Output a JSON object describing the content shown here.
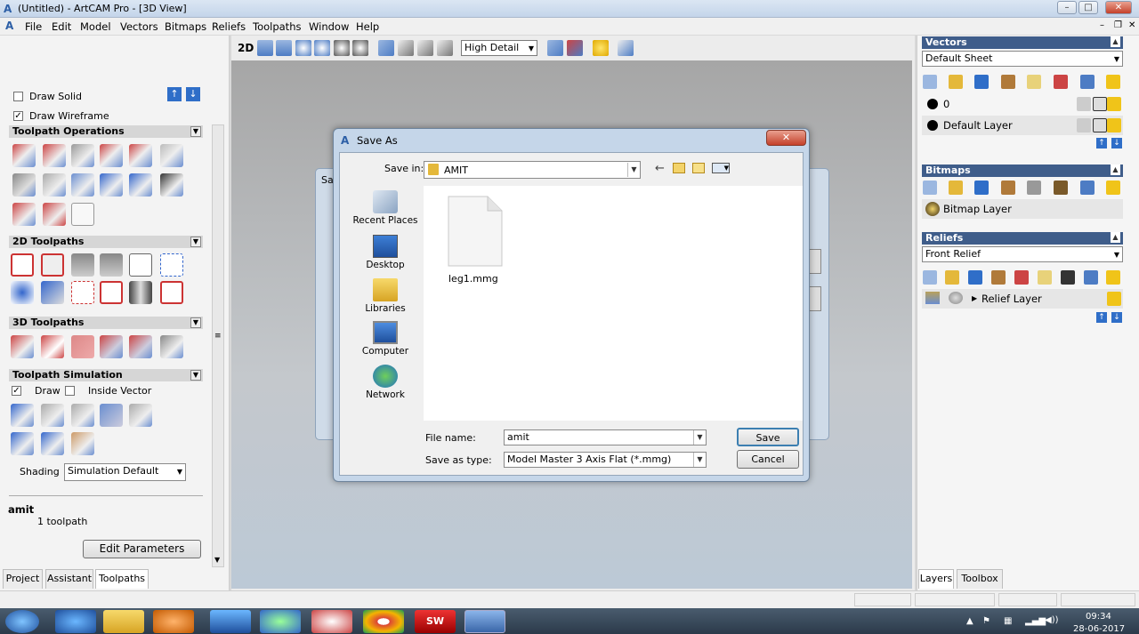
{
  "window": {
    "title": "(Untitled) - ArtCAM Pro - [3D View]",
    "colors": {
      "accent": "#3f5d8a",
      "close": "#c4402a"
    }
  },
  "menu": [
    "File",
    "Edit",
    "Model",
    "Vectors",
    "Bitmaps",
    "Reliefs",
    "Toolpaths",
    "Window",
    "Help"
  ],
  "left": {
    "draw_solid": "Draw Solid",
    "draw_wireframe": "Draw Wireframe",
    "sections": {
      "toolpath_ops": "Toolpath Operations",
      "toolpaths_2d": "2D Toolpaths",
      "toolpaths_3d": "3D Toolpaths",
      "simulation": "Toolpath Simulation"
    },
    "draw": "Draw",
    "inside_vector": "Inside Vector",
    "shading_label": "Shading",
    "shading_value": "Simulation Default",
    "item_name": "amit",
    "item_count": "1 toolpath",
    "edit_params": "Edit Parameters",
    "tabs": [
      "Project",
      "Assistant",
      "Toolpaths"
    ]
  },
  "toolbar": {
    "mode_2d": "2D",
    "detail": "High Detail"
  },
  "right": {
    "vectors": {
      "title": "Vectors",
      "sheet": "Default Sheet",
      "layer0": "0",
      "default_layer": "Default Layer"
    },
    "bitmaps": {
      "title": "Bitmaps",
      "layer": "Bitmap Layer"
    },
    "reliefs": {
      "title": "Reliefs",
      "sheet": "Front Relief",
      "layer": "Relief Layer"
    },
    "tabs": [
      "Layers",
      "Toolbox"
    ]
  },
  "dialog": {
    "title": "Save As",
    "save_in_label": "Save in:",
    "save_in_value": "AMIT",
    "places": [
      "Recent Places",
      "Desktop",
      "Libraries",
      "Computer",
      "Network"
    ],
    "file": "leg1.mmg",
    "file_name_label": "File name:",
    "file_name_value": "amit",
    "save_type_label": "Save as type:",
    "save_type_value": "Model Master 3 Axis Flat (*.mmg)",
    "save_button": "Save",
    "cancel_button": "Cancel",
    "bg_title_fragment": "Sa"
  },
  "taskbar": {
    "time": "09:34",
    "date": "28-06-2017",
    "solidworks_badge": "SW"
  }
}
